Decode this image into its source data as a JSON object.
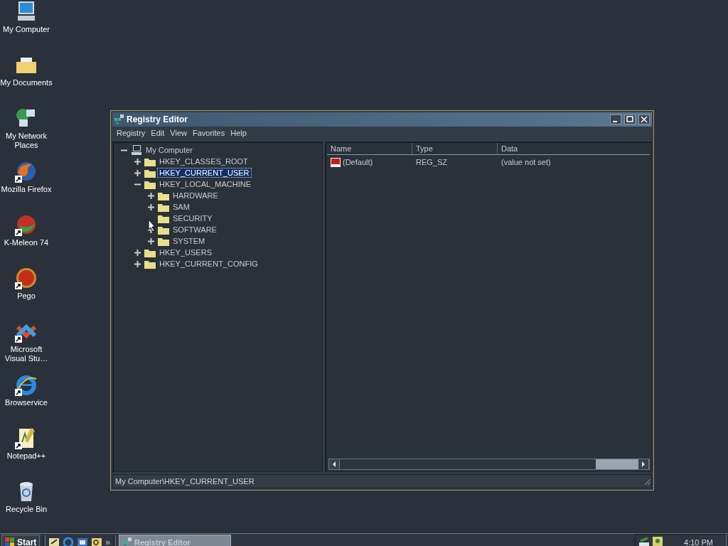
{
  "desktop_icons": [
    {
      "label": "My Computer",
      "kind": "computer",
      "shortcut": false
    },
    {
      "label": "My Documents",
      "kind": "documents",
      "shortcut": false
    },
    {
      "label": "My Network Places",
      "kind": "network",
      "shortcut": false
    },
    {
      "label": "Mozilla Firefox",
      "kind": "fox",
      "shortcut": true
    },
    {
      "label": "K-Meleon 74",
      "kind": "chameleon",
      "shortcut": true
    },
    {
      "label": "Pego",
      "kind": "ball",
      "shortcut": true
    },
    {
      "label": "Microsoft Visual Stu…",
      "kind": "studio",
      "shortcut": true
    },
    {
      "label": "Browservice",
      "kind": "ie",
      "shortcut": true
    },
    {
      "label": "Notepad++",
      "kind": "notepad",
      "shortcut": true
    },
    {
      "label": "Recycle Bin",
      "kind": "bin",
      "shortcut": false
    }
  ],
  "window": {
    "title": "Registry Editor",
    "menu": [
      "Registry",
      "Edit",
      "View",
      "Favorites",
      "Help"
    ],
    "tree": [
      {
        "label": "My Computer",
        "kind": "computer",
        "expandable": true,
        "expanded": true,
        "selected": false,
        "children": [
          {
            "label": "HKEY_CLASSES_ROOT",
            "kind": "folder",
            "expandable": true,
            "expanded": false,
            "selected": false
          },
          {
            "label": "HKEY_CURRENT_USER",
            "kind": "folder",
            "expandable": true,
            "expanded": false,
            "selected": true
          },
          {
            "label": "HKEY_LOCAL_MACHINE",
            "kind": "folder",
            "expandable": true,
            "expanded": true,
            "selected": false,
            "children": [
              {
                "label": "HARDWARE",
                "kind": "folder",
                "expandable": true,
                "expanded": false,
                "selected": false
              },
              {
                "label": "SAM",
                "kind": "folder",
                "expandable": true,
                "expanded": false,
                "selected": false
              },
              {
                "label": "SECURITY",
                "kind": "folder",
                "expandable": false,
                "selected": false
              },
              {
                "label": "SOFTWARE",
                "kind": "folder",
                "expandable": true,
                "expanded": false,
                "selected": false
              },
              {
                "label": "SYSTEM",
                "kind": "folder",
                "expandable": true,
                "expanded": false,
                "selected": false
              }
            ]
          },
          {
            "label": "HKEY_USERS",
            "kind": "folder",
            "expandable": true,
            "expanded": false,
            "selected": false
          },
          {
            "label": "HKEY_CURRENT_CONFIG",
            "kind": "folder",
            "expandable": true,
            "expanded": false,
            "selected": false
          }
        ]
      }
    ],
    "list": {
      "columns": [
        "Name",
        "Type",
        "Data"
      ],
      "rows": [
        {
          "name": "(Default)",
          "type": "REG_SZ",
          "data": "(value not set)"
        }
      ]
    },
    "status_bar": "My Computer\\HKEY_CURRENT_USER"
  },
  "taskbar": {
    "start": "Start",
    "more": "»",
    "tasks": [
      {
        "label": "Registry Editor",
        "selected": true
      }
    ],
    "clock": "4:10 PM"
  }
}
